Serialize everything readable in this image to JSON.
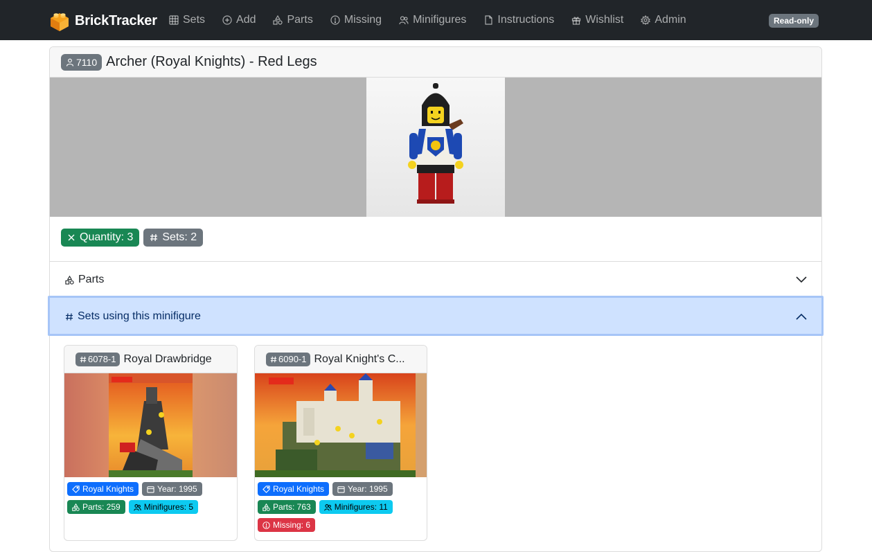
{
  "app": {
    "brand": "BrickTracker",
    "readonly_badge": "Read-only"
  },
  "nav": [
    {
      "label": "Sets",
      "icon": "grid-icon"
    },
    {
      "label": "Add",
      "icon": "plus-circle-icon"
    },
    {
      "label": "Parts",
      "icon": "shapes-icon"
    },
    {
      "label": "Missing",
      "icon": "alert-circle-icon"
    },
    {
      "label": "Minifigures",
      "icon": "users-icon"
    },
    {
      "label": "Instructions",
      "icon": "file-icon"
    },
    {
      "label": "Wishlist",
      "icon": "gift-icon"
    },
    {
      "label": "Admin",
      "icon": "gear-icon"
    }
  ],
  "minifigure": {
    "id": "7110",
    "name": "Archer (Royal Knights) - Red Legs",
    "quantity_label": "Quantity: 3",
    "sets_label": "Sets: 2"
  },
  "accordion": {
    "parts_label": "Parts",
    "sets_label": "Sets using this minifigure"
  },
  "sets": [
    {
      "id": "6078-1",
      "name": "Royal Drawbridge",
      "theme": "Royal Knights",
      "year": "Year: 1995",
      "parts": "Parts: 259",
      "minifigures": "Minifigures: 5",
      "missing": ""
    },
    {
      "id": "6090-1",
      "name": "Royal Knight's C...",
      "theme": "Royal Knights",
      "year": "Year: 1995",
      "parts": "Parts: 763",
      "minifigures": "Minifigures: 11",
      "missing": "Missing: 6"
    }
  ],
  "colors": {
    "navbar": "#212529",
    "success": "#198754",
    "secondary": "#6c757d",
    "primary": "#0d6efd",
    "info": "#0dcaf0",
    "danger": "#dc3545",
    "accordion_active": "#cfe2ff"
  }
}
